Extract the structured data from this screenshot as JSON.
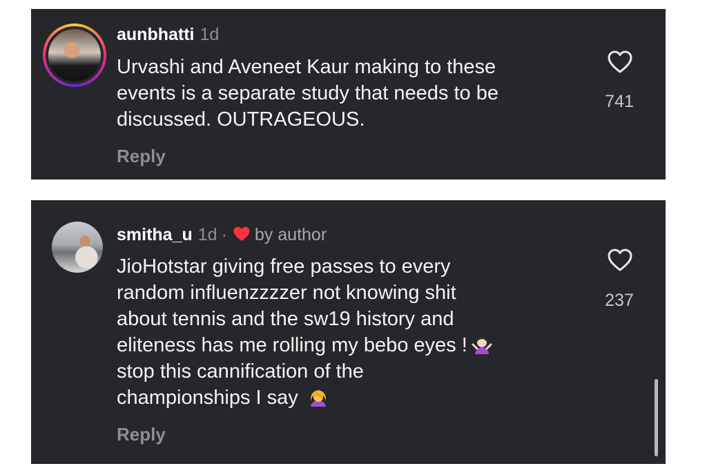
{
  "comments": [
    {
      "username": "aunbhatti",
      "time": "1d",
      "lines": [
        "Urvashi and Aveneet Kaur making to these",
        "events is a separate study that needs to be",
        "discussed. OUTRAGEOUS."
      ],
      "reply_label": "Reply",
      "like_count": "741",
      "like_icon": "heart-outline-icon"
    },
    {
      "username": "smitha_u",
      "time": "1d",
      "separator": "·",
      "by_author_label": "by author",
      "by_author_icon": "red-heart-icon",
      "lines": [
        "JioHotstar giving free passes to every",
        "random influenzzzzer not knowing shit",
        "about tennis and the sw19 history and",
        "eliteness has me rolling my bebo eyes !",
        "stop this cannification of the",
        "championships I say"
      ],
      "emojis": [
        "shrug-emoji-icon",
        "facepalm-emoji-icon"
      ],
      "reply_label": "Reply",
      "like_count": "237",
      "like_icon": "heart-outline-icon"
    }
  ],
  "colors": {
    "card_background": "#26272b",
    "page_background": "#ffffff",
    "muted_text": "#8e8e93",
    "author_heart": "#ff3040"
  }
}
